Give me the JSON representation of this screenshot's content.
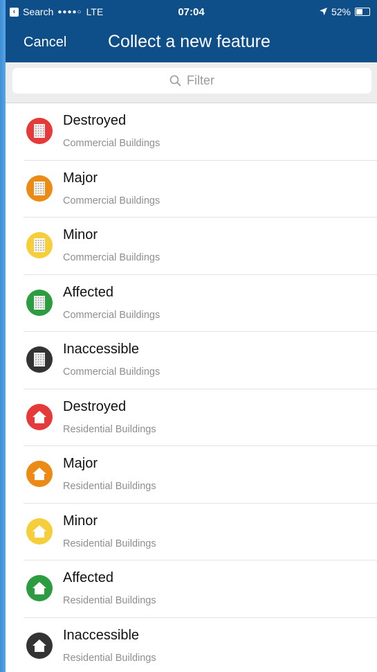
{
  "status_bar": {
    "back_app": "Search",
    "signal": "●●●●○",
    "network": "LTE",
    "time": "07:04",
    "battery": "52%",
    "battery_level": 0.52
  },
  "nav": {
    "cancel_label": "Cancel",
    "title": "Collect a new feature"
  },
  "filter": {
    "placeholder": "Filter"
  },
  "colors": {
    "bar": "#0e4f8a",
    "destroyed": "#e63a3a",
    "major": "#ec8a16",
    "minor": "#f6cd3a",
    "affected": "#2d9b3f",
    "inaccessible": "#333333"
  },
  "features": [
    {
      "title": "Destroyed",
      "subtitle": "Commercial Buildings",
      "icon": "commercial-building-icon",
      "color": "#e63a3a"
    },
    {
      "title": "Major",
      "subtitle": "Commercial Buildings",
      "icon": "commercial-building-icon",
      "color": "#ec8a16"
    },
    {
      "title": "Minor",
      "subtitle": "Commercial Buildings",
      "icon": "commercial-building-icon",
      "color": "#f6cd3a"
    },
    {
      "title": "Affected",
      "subtitle": "Commercial Buildings",
      "icon": "commercial-building-icon",
      "color": "#2d9b3f"
    },
    {
      "title": "Inaccessible",
      "subtitle": "Commercial Buildings",
      "icon": "commercial-building-icon",
      "color": "#333333"
    },
    {
      "title": "Destroyed",
      "subtitle": "Residential Buildings",
      "icon": "residential-house-icon",
      "color": "#e63a3a"
    },
    {
      "title": "Major",
      "subtitle": "Residential Buildings",
      "icon": "residential-house-icon",
      "color": "#ec8a16"
    },
    {
      "title": "Minor",
      "subtitle": "Residential Buildings",
      "icon": "residential-house-icon",
      "color": "#f6cd3a"
    },
    {
      "title": "Affected",
      "subtitle": "Residential Buildings",
      "icon": "residential-house-icon",
      "color": "#2d9b3f"
    },
    {
      "title": "Inaccessible",
      "subtitle": "Residential Buildings",
      "icon": "residential-house-icon",
      "color": "#333333"
    }
  ]
}
